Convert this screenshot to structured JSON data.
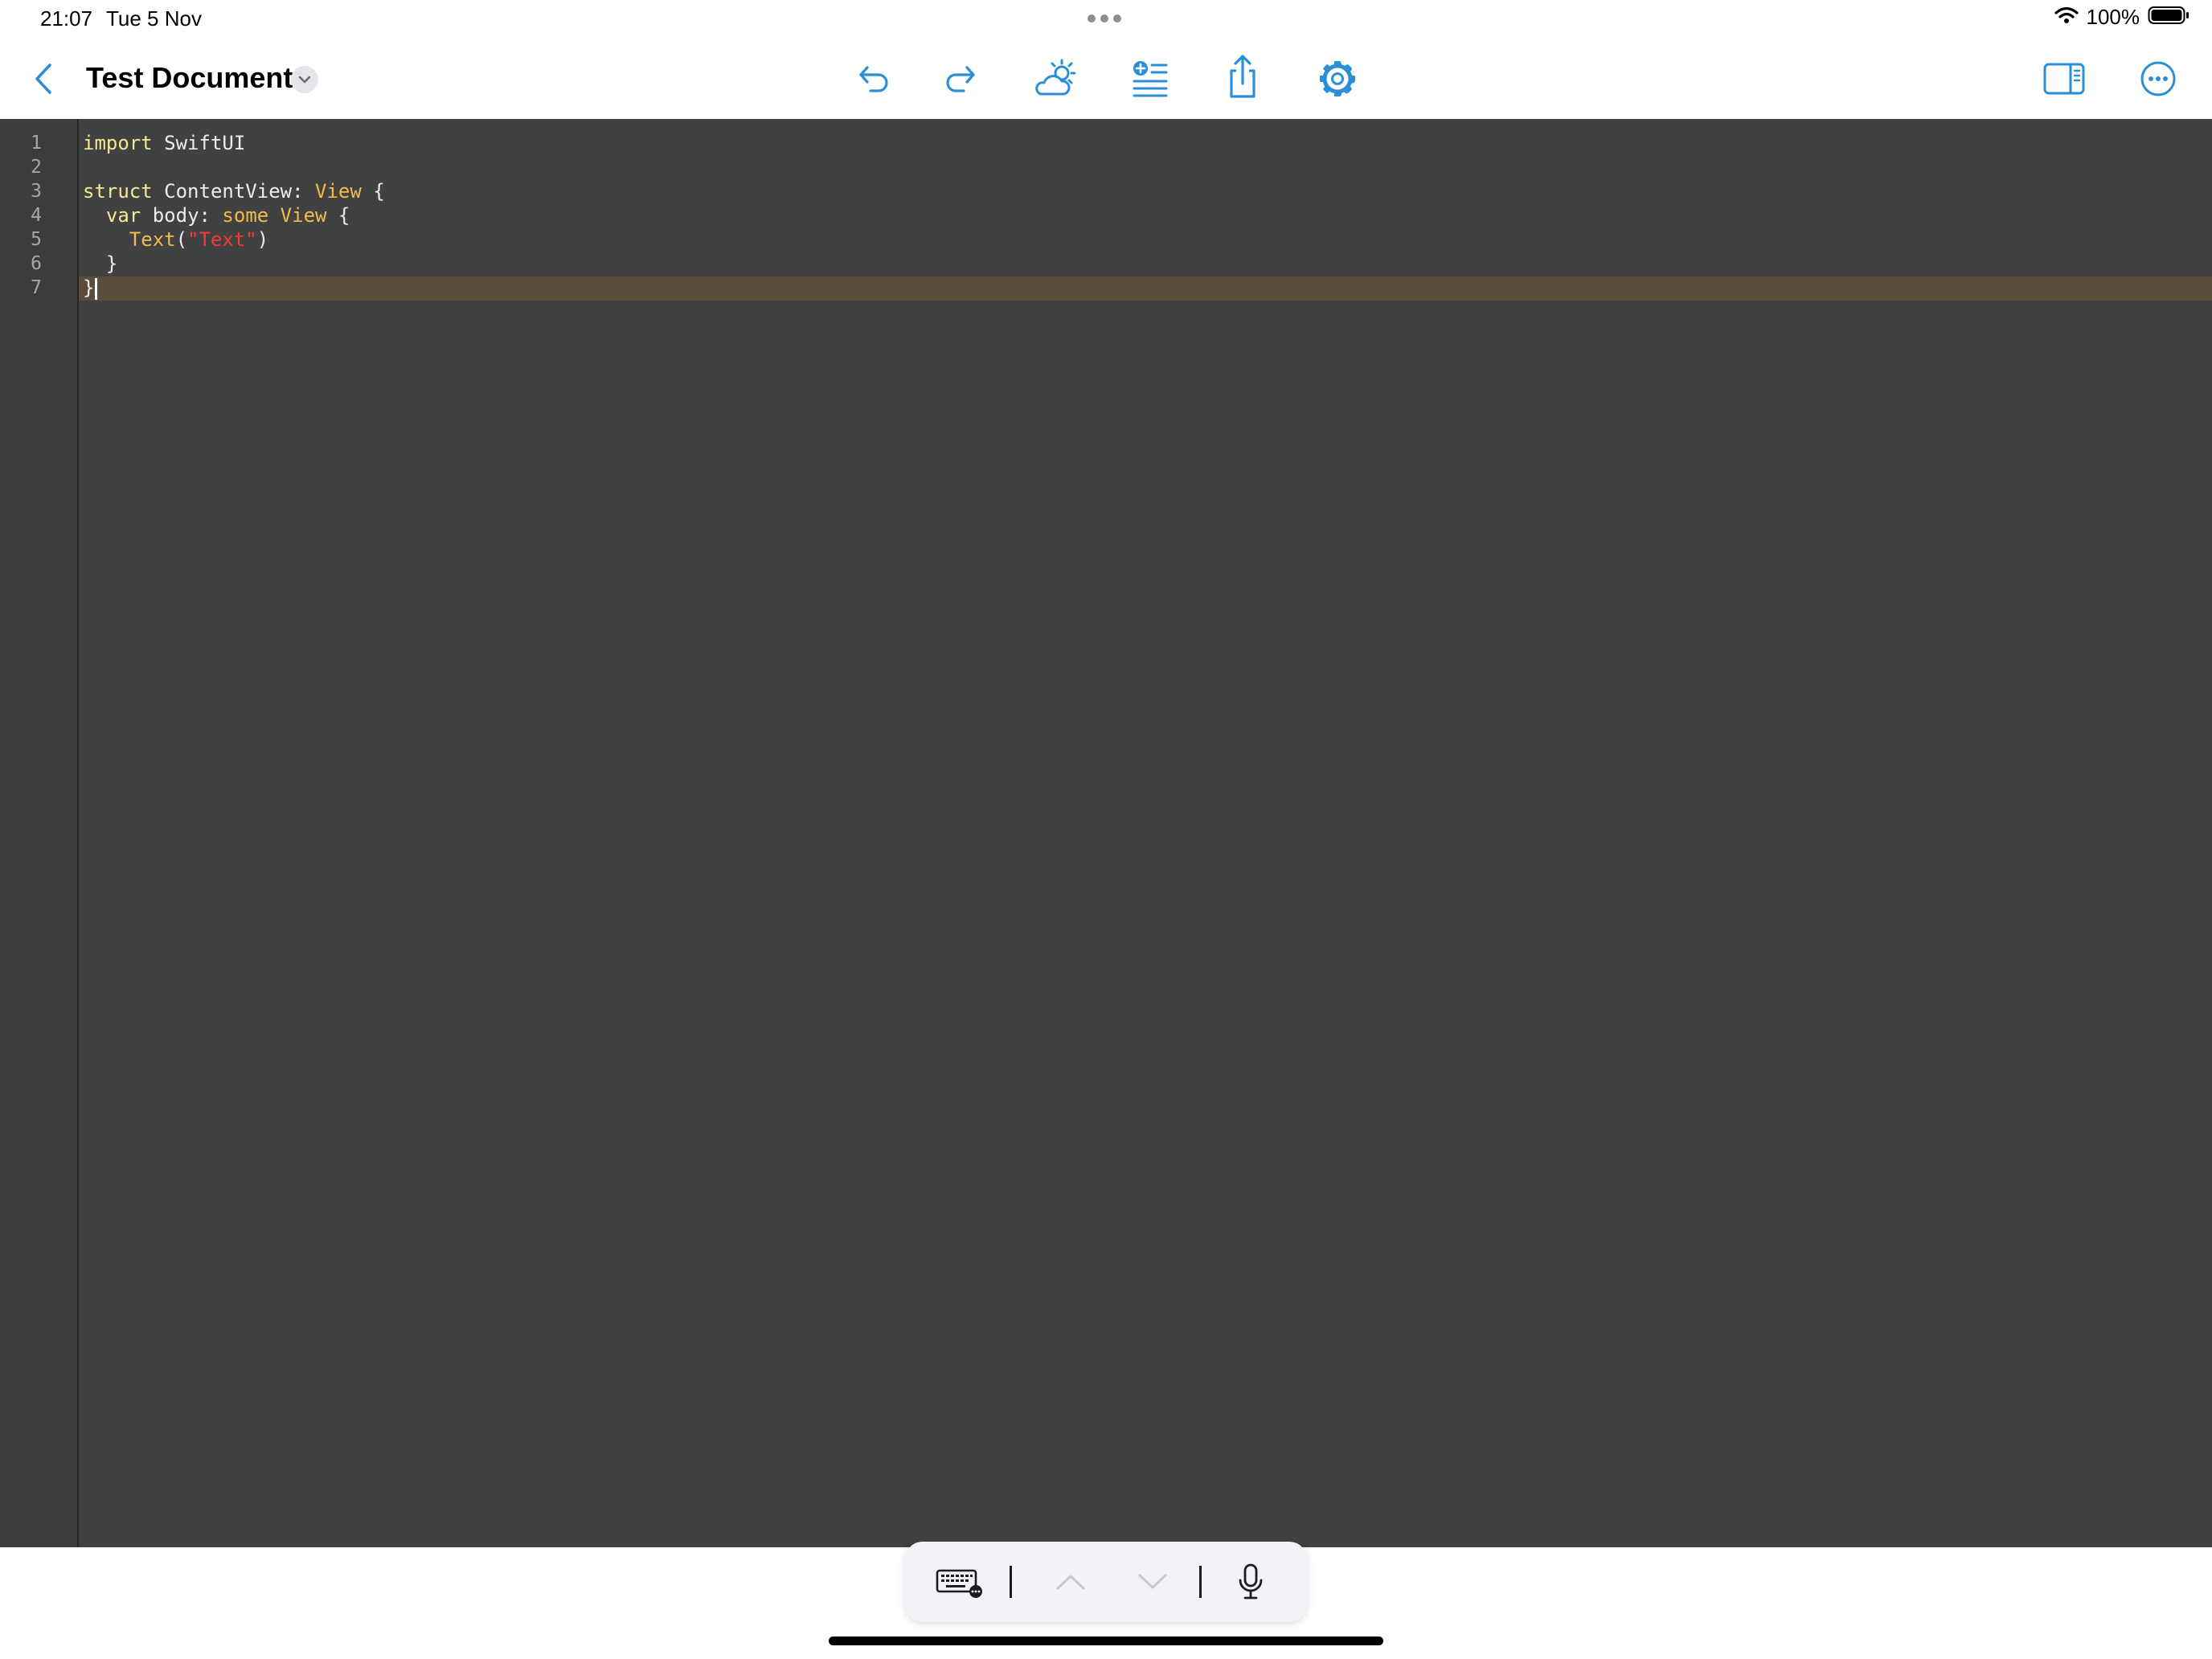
{
  "status_bar": {
    "time": "21:07",
    "date": "Tue 5 Nov",
    "battery_percent": "100%",
    "battery_level": 1.0
  },
  "toolbar": {
    "document_title": "Test Document",
    "icons": [
      "back-chevron-icon",
      "chevron-down-icon",
      "undo-icon",
      "redo-icon",
      "weather-icon",
      "insert-list-icon",
      "share-icon",
      "gear-icon",
      "sidebar-icon",
      "more-icon"
    ],
    "accent_color": "#2a8fd6"
  },
  "editor": {
    "line_numbers": [
      "1",
      "2",
      "3",
      "4",
      "5",
      "6",
      "7"
    ],
    "current_line": "7",
    "code": {
      "l1": {
        "kw": "import",
        "rest": " SwiftUI"
      },
      "l3": {
        "kw": "struct",
        "name": " ContentView: ",
        "type": "View",
        "rest": " {"
      },
      "l4": {
        "indent": "  ",
        "kw": "var",
        "name": " body: ",
        "some": "some",
        "sp": " ",
        "type": "View",
        "rest": " {"
      },
      "l5": {
        "indent": "    ",
        "type": "Text",
        "open": "(",
        "str": "\"Text\"",
        "close": ")"
      },
      "l6": {
        "text": "  }"
      },
      "l7": {
        "text": "}"
      }
    },
    "colors": {
      "background": "#414141",
      "keyword": "#f4e890",
      "type": "#f2bb4b",
      "string": "#f13a3a",
      "current_line": "#5a4e3a"
    }
  },
  "shortcut_bar": {
    "icons": [
      "keyboard-icon",
      "chevron-up-icon",
      "chevron-down-icon",
      "microphone-icon"
    ]
  }
}
